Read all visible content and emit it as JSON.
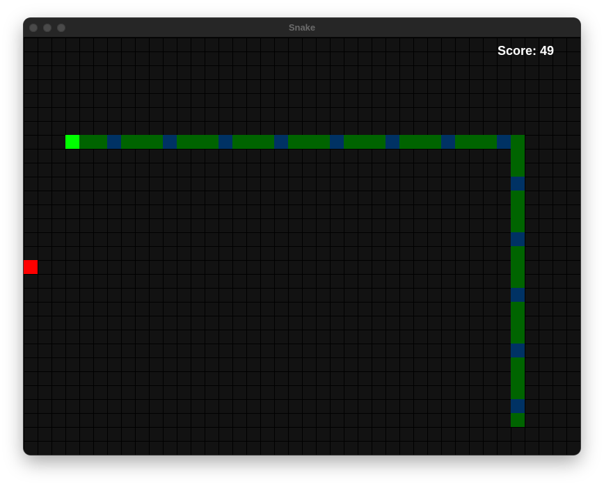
{
  "window": {
    "title": "Snake"
  },
  "hud": {
    "score_text": "Score: 49"
  },
  "colors": {
    "head": "#00ff00",
    "body": "#006400",
    "body_stripe": "#003264",
    "food": "#ff0000",
    "background": "#121212",
    "grid": "#000000"
  },
  "game": {
    "grid_cols": 40,
    "grid_rows": 30,
    "food": [
      0,
      16
    ],
    "snake": [
      [
        3,
        7
      ],
      [
        4,
        7
      ],
      [
        5,
        7
      ],
      [
        6,
        7
      ],
      [
        7,
        7
      ],
      [
        8,
        7
      ],
      [
        9,
        7
      ],
      [
        10,
        7
      ],
      [
        11,
        7
      ],
      [
        12,
        7
      ],
      [
        13,
        7
      ],
      [
        14,
        7
      ],
      [
        15,
        7
      ],
      [
        16,
        7
      ],
      [
        17,
        7
      ],
      [
        18,
        7
      ],
      [
        19,
        7
      ],
      [
        20,
        7
      ],
      [
        21,
        7
      ],
      [
        22,
        7
      ],
      [
        23,
        7
      ],
      [
        24,
        7
      ],
      [
        25,
        7
      ],
      [
        26,
        7
      ],
      [
        27,
        7
      ],
      [
        28,
        7
      ],
      [
        29,
        7
      ],
      [
        30,
        7
      ],
      [
        31,
        7
      ],
      [
        32,
        7
      ],
      [
        33,
        7
      ],
      [
        34,
        7
      ],
      [
        35,
        7
      ],
      [
        35,
        8
      ],
      [
        35,
        9
      ],
      [
        35,
        10
      ],
      [
        35,
        11
      ],
      [
        35,
        12
      ],
      [
        35,
        13
      ],
      [
        35,
        14
      ],
      [
        35,
        15
      ],
      [
        35,
        16
      ],
      [
        35,
        17
      ],
      [
        35,
        18
      ],
      [
        35,
        19
      ],
      [
        35,
        20
      ],
      [
        35,
        21
      ],
      [
        35,
        22
      ],
      [
        35,
        23
      ],
      [
        35,
        24
      ],
      [
        35,
        25
      ],
      [
        35,
        26
      ],
      [
        35,
        27
      ]
    ]
  }
}
